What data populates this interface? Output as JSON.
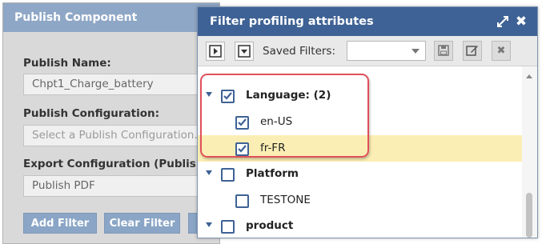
{
  "background_dialog": {
    "title": "Publish Component",
    "fields": [
      {
        "label": "Publish Name:",
        "value": "Chpt1_Charge_battery"
      },
      {
        "label": "Publish Configuration:",
        "placeholder": "Select a Publish Configuration..."
      },
      {
        "label": "Export Configuration (Publish):",
        "value": "Publish PDF"
      }
    ],
    "buttons": {
      "add_filter": "Add Filter",
      "clear_filter": "Clear Filter"
    }
  },
  "filter_panel": {
    "title": "Filter profiling attributes",
    "header_icons": [
      "expand-icon",
      "close-icon"
    ],
    "toolbar": {
      "saved_filters_label": "Saved Filters:",
      "saved_filters_value": "",
      "icons": [
        "play-icon",
        "collapse-icon",
        "save-icon",
        "edit-icon",
        "delete-icon"
      ]
    },
    "tree": [
      {
        "label": "Language: (2)",
        "level": 0,
        "expanded": true,
        "checked": true,
        "bold": true
      },
      {
        "label": "en-US",
        "level": 1,
        "checked": true,
        "bold": false
      },
      {
        "label": "fr-FR",
        "level": 1,
        "checked": true,
        "bold": false,
        "highlighted": true
      },
      {
        "label": "Platform",
        "level": 0,
        "expanded": true,
        "checked": false,
        "bold": true
      },
      {
        "label": "TESTONE",
        "level": 1,
        "checked": false,
        "bold": false
      },
      {
        "label": "product",
        "level": 0,
        "expanded": true,
        "checked": false,
        "bold": true
      }
    ]
  },
  "colors": {
    "panel_header": "#3e6295",
    "bg_header": "#8fa7c6",
    "highlight": "#fbeeb4",
    "callout": "#e0505a"
  }
}
